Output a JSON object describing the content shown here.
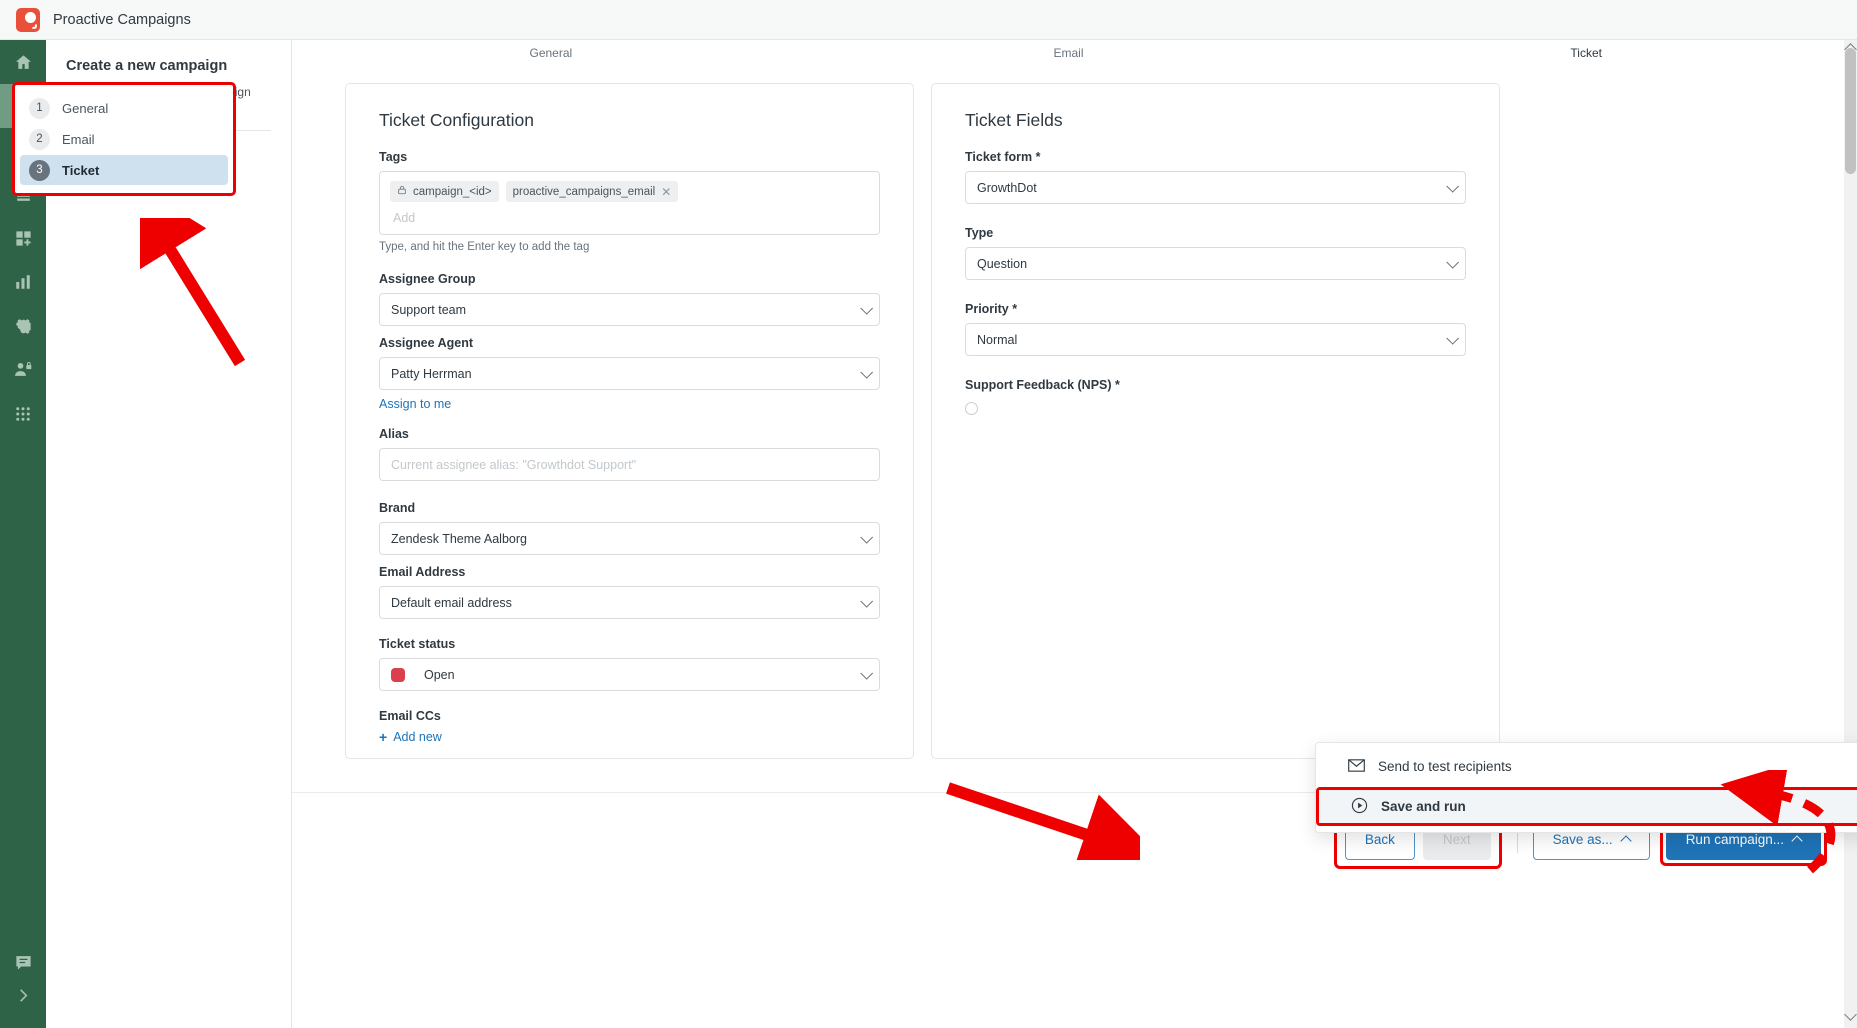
{
  "app": {
    "title": "Proactive Campaigns",
    "logo_icon": "proactive-campaigns-logo"
  },
  "rail": {
    "items": [
      {
        "icon": "home-icon",
        "name": "home",
        "active": false
      },
      {
        "icon": "mail-icon",
        "name": "campaigns",
        "active": true
      },
      {
        "icon": "automation-icon",
        "name": "automations",
        "active": false
      },
      {
        "icon": "database-icon",
        "name": "templates",
        "active": false
      },
      {
        "icon": "add-blocks-icon",
        "name": "add-blocks",
        "active": false
      },
      {
        "icon": "bar-chart-icon",
        "name": "reports",
        "active": false
      },
      {
        "icon": "gear-icon",
        "name": "settings",
        "active": false
      },
      {
        "icon": "user-lock-icon",
        "name": "permissions",
        "active": false
      },
      {
        "icon": "grid-apps-icon",
        "name": "apps",
        "active": false
      }
    ],
    "bottom_items": [
      {
        "icon": "chat-icon",
        "name": "support-chat"
      },
      {
        "icon": "chevron-right-icon",
        "name": "expand-rail"
      }
    ]
  },
  "sidebar": {
    "title": "Create a new campaign",
    "subtitle": "Navigate faster between campaign steps using buttons below:",
    "steps": [
      {
        "num": "1",
        "label": "General",
        "active": false
      },
      {
        "num": "2",
        "label": "Email",
        "active": false
      },
      {
        "num": "3",
        "label": "Ticket",
        "active": true
      }
    ]
  },
  "tabs": [
    {
      "label": "General",
      "active": false
    },
    {
      "label": "Email",
      "active": false
    },
    {
      "label": "Ticket",
      "active": true
    }
  ],
  "ticket_configuration": {
    "title": "Ticket Configuration",
    "tags_label": "Tags",
    "tags": [
      {
        "text": "campaign_<id>",
        "locked": true,
        "removable": false
      },
      {
        "text": "proactive_campaigns_email",
        "locked": false,
        "removable": true
      }
    ],
    "tags_input_placeholder": "Add",
    "tags_hint": "Type, and hit the Enter key to add the tag",
    "assignee_group_label": "Assignee Group",
    "assignee_group_value": "Support team",
    "assignee_agent_label": "Assignee Agent",
    "assignee_agent_value": "Patty Herrman",
    "assign_to_me_label": "Assign to me",
    "alias_label": "Alias",
    "alias_placeholder": "Current assignee alias: \"Growthdot Support\"",
    "brand_label": "Brand",
    "brand_value": "Zendesk Theme Aalborg",
    "email_address_label": "Email Address",
    "email_address_value": "Default email address",
    "ticket_status_label": "Ticket status",
    "ticket_status_value": "Open",
    "ticket_status_color": "#d93f4c",
    "email_ccs_label": "Email CCs",
    "email_ccs_add_label": "Add new"
  },
  "ticket_fields": {
    "title": "Ticket Fields",
    "ticket_form_label": "Ticket form *",
    "ticket_form_value": "GrowthDot",
    "type_label": "Type",
    "type_value": "Question",
    "priority_label": "Priority *",
    "priority_value": "Normal",
    "nps_label": "Support Feedback (NPS) *"
  },
  "actionbar": {
    "back_label": "Back",
    "next_label": "Next",
    "save_as_label": "Save as...",
    "run_campaign_label": "Run campaign..."
  },
  "run_menu": {
    "items": [
      {
        "label": "Send to test recipients",
        "icon": "envelope-icon",
        "highlighted": false
      },
      {
        "label": "Save and run",
        "icon": "play-circle-icon",
        "highlighted": true
      }
    ]
  },
  "colors": {
    "rail_bg": "#2e6347",
    "rail_active": "#709c83",
    "primary": "#1f73b7",
    "annotation": "#ee0000",
    "step_active_bg": "#cfe0ee"
  }
}
